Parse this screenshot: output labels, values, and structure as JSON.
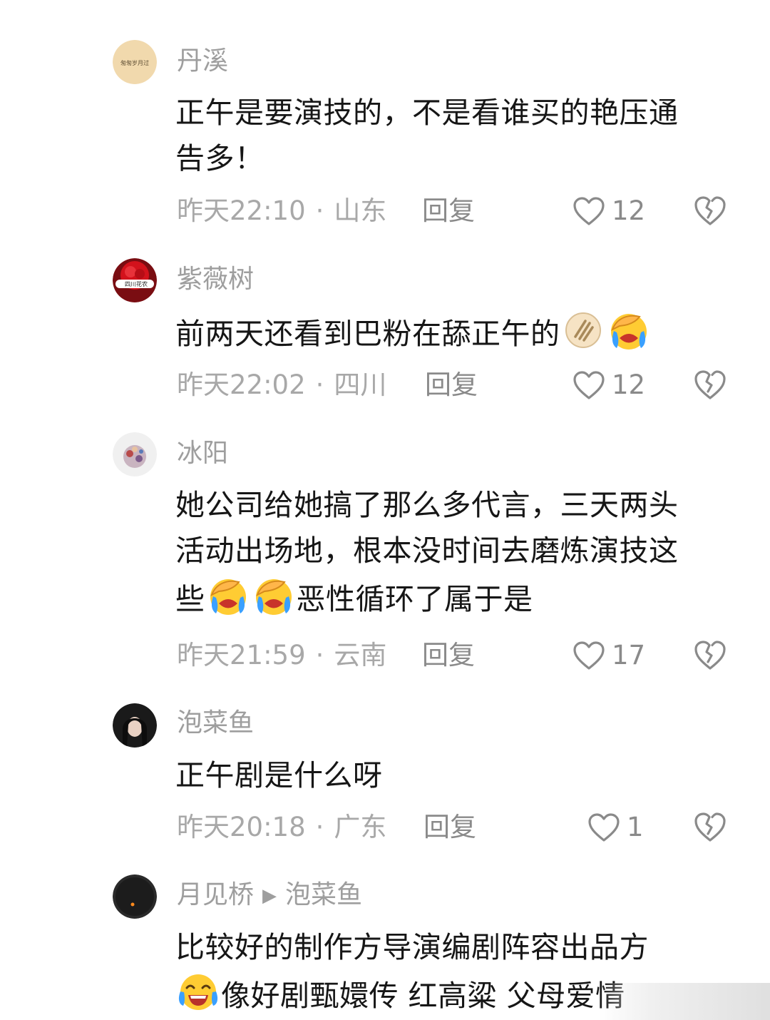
{
  "comments": [
    {
      "username": "丹溪",
      "avatar_text": "匆匆岁月过",
      "lines": [
        "正午是要演技的，不是看谁买的艳压通",
        "告多！"
      ],
      "time": "昨天22:10",
      "region": "山东",
      "reply_label": "回复",
      "likes": "12"
    },
    {
      "username": "紫薇树",
      "avatar_text": "四川花农",
      "line": "前两天还看到巴粉在舔正午的",
      "time": "昨天22:02",
      "region": "四川",
      "reply_label": "回复",
      "likes": "12"
    },
    {
      "username": "冰阳",
      "lines": [
        "她公司给她搞了那么多代言，三天两头",
        "活动出场地，根本没时间去磨炼演技这",
        "些"
      ],
      "line3_tail": "恶性循环了属于是",
      "time": "昨天21:59",
      "region": "云南",
      "reply_label": "回复",
      "likes": "17"
    },
    {
      "username": "泡菜鱼",
      "line": "正午剧是什么呀",
      "time": "昨天20:18",
      "region": "广东",
      "reply_label": "回复",
      "likes": "1"
    },
    {
      "username": "月见桥",
      "reply_to": "泡菜鱼",
      "line1": "比较好的制作方导演编剧阵容出品方",
      "line2": "像好剧甄嬛传 红高粱 父母爱情"
    }
  ],
  "icons": {
    "like": "heart-outline-icon",
    "dislike": "broken-heart-icon",
    "emoji_facepalm": "facepalm-crying-emoji",
    "emoji_laugh": "tears-of-joy-emoji",
    "emoji_handshake": "hand-pattern-emoji"
  },
  "colors": {
    "text": "#161616",
    "muted": "#9e9e9e"
  }
}
